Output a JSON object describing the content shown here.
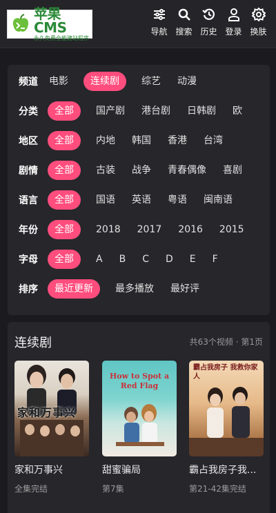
{
  "header": {
    "logo_title": "苹果CMS",
    "logo_subtitle": "永久免费全能建站程序",
    "nav": [
      {
        "label": "导航",
        "icon": "sliders-icon"
      },
      {
        "label": "搜索",
        "icon": "search-icon"
      },
      {
        "label": "历史",
        "icon": "history-icon"
      },
      {
        "label": "登录",
        "icon": "user-icon"
      },
      {
        "label": "换肤",
        "icon": "gear-icon"
      }
    ]
  },
  "filters": [
    {
      "label": "频道",
      "options": [
        "电影",
        "连续剧",
        "综艺",
        "动漫"
      ],
      "active": 1
    },
    {
      "label": "分类",
      "options": [
        "全部",
        "国产剧",
        "港台剧",
        "日韩剧",
        "欧"
      ],
      "active": 0
    },
    {
      "label": "地区",
      "options": [
        "全部",
        "内地",
        "韩国",
        "香港",
        "台湾"
      ],
      "active": 0
    },
    {
      "label": "剧情",
      "options": [
        "全部",
        "古装",
        "战争",
        "青春偶像",
        "喜剧"
      ],
      "active": 0
    },
    {
      "label": "语言",
      "options": [
        "全部",
        "国语",
        "英语",
        "粤语",
        "闽南语"
      ],
      "active": 0
    },
    {
      "label": "年份",
      "options": [
        "全部",
        "2018",
        "2017",
        "2016",
        "2015"
      ],
      "active": 0
    },
    {
      "label": "字母",
      "options": [
        "全部",
        "A",
        "B",
        "C",
        "D",
        "E",
        "F"
      ],
      "active": 0
    },
    {
      "label": "排序",
      "options": [
        "最近更新",
        "最多播放",
        "最好评"
      ],
      "active": 0
    }
  ],
  "list": {
    "title": "连续剧",
    "meta": "共63个视频 · 第1页",
    "items": [
      {
        "title": "家和万事兴",
        "status": "全集完结",
        "poster_text": "家和万事兴"
      },
      {
        "title": "甜蜜骗局",
        "status": "第7集",
        "poster_text": "How to Spot a Red Flag"
      },
      {
        "title": "霸占我房子我...",
        "status": "第21-42集完结",
        "poster_text": "霸占我房子 我救你家人"
      }
    ]
  },
  "colors": {
    "accent": "#ff4d7d",
    "background": "#1b1b1f",
    "panel": "#26262b"
  }
}
